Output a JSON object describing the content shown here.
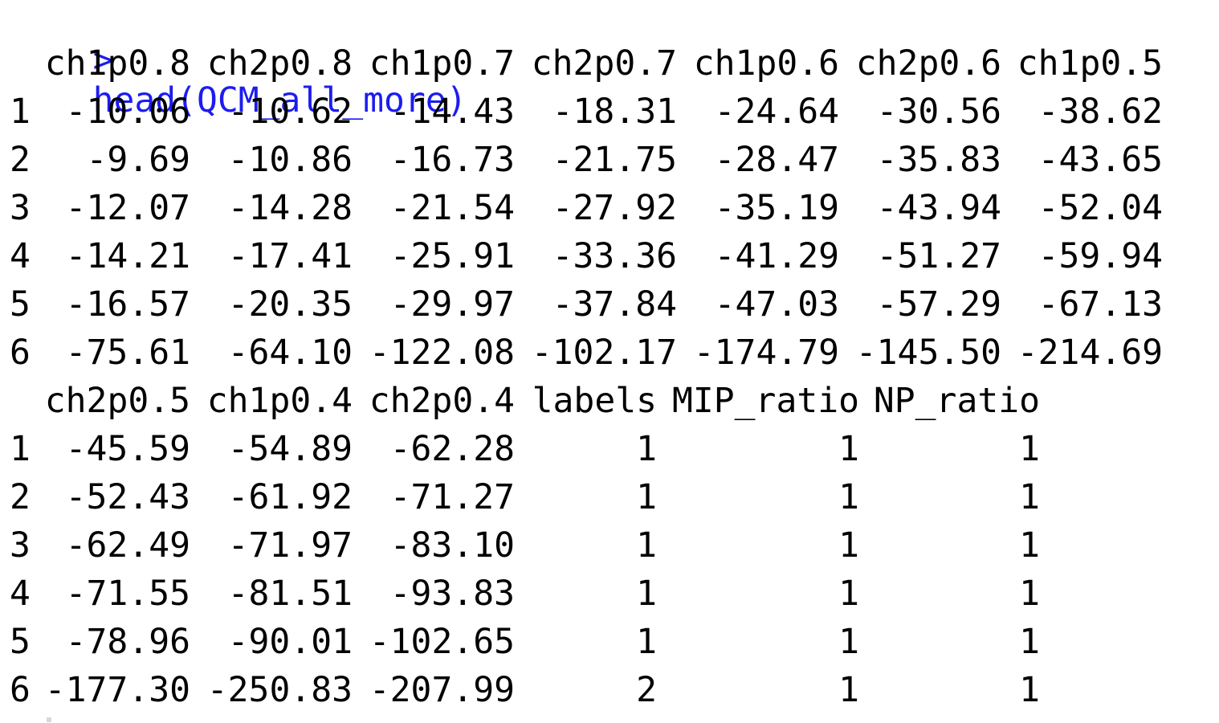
{
  "console": {
    "prompt": ">",
    "command": "head(QCM_all_more)",
    "colors": {
      "command": "#1c1cf0",
      "output": "#000000",
      "background": "#ffffff"
    }
  },
  "blocks": [
    {
      "headers": [
        "ch1p0.8",
        "ch2p0.8",
        "ch1p0.7",
        "ch2p0.7",
        "ch1p0.6",
        "ch2p0.6",
        "ch1p0.5"
      ],
      "rows": [
        {
          "name": "1",
          "cells": [
            "-10.06",
            "-10.62",
            "-14.43",
            "-18.31",
            "-24.64",
            "-30.56",
            "-38.62"
          ]
        },
        {
          "name": "2",
          "cells": [
            "-9.69",
            "-10.86",
            "-16.73",
            "-21.75",
            "-28.47",
            "-35.83",
            "-43.65"
          ]
        },
        {
          "name": "3",
          "cells": [
            "-12.07",
            "-14.28",
            "-21.54",
            "-27.92",
            "-35.19",
            "-43.94",
            "-52.04"
          ]
        },
        {
          "name": "4",
          "cells": [
            "-14.21",
            "-17.41",
            "-25.91",
            "-33.36",
            "-41.29",
            "-51.27",
            "-59.94"
          ]
        },
        {
          "name": "5",
          "cells": [
            "-16.57",
            "-20.35",
            "-29.97",
            "-37.84",
            "-47.03",
            "-57.29",
            "-67.13"
          ]
        },
        {
          "name": "6",
          "cells": [
            "-75.61",
            "-64.10",
            "-122.08",
            "-102.17",
            "-174.79",
            "-145.50",
            "-214.69"
          ]
        }
      ]
    },
    {
      "headers": [
        "ch2p0.5",
        "ch1p0.4",
        "ch2p0.4",
        "labels",
        "MIP_ratio",
        "NP_ratio"
      ],
      "rows": [
        {
          "name": "1",
          "cells": [
            "-45.59",
            "-54.89",
            "-62.28",
            "1",
            "1",
            "1"
          ]
        },
        {
          "name": "2",
          "cells": [
            "-52.43",
            "-61.92",
            "-71.27",
            "1",
            "1",
            "1"
          ]
        },
        {
          "name": "3",
          "cells": [
            "-62.49",
            "-71.97",
            "-83.10",
            "1",
            "1",
            "1"
          ]
        },
        {
          "name": "4",
          "cells": [
            "-71.55",
            "-81.51",
            "-93.83",
            "1",
            "1",
            "1"
          ]
        },
        {
          "name": "5",
          "cells": [
            "-78.96",
            "-90.01",
            "-102.65",
            "1",
            "1",
            "1"
          ]
        },
        {
          "name": "6",
          "cells": [
            "-177.30",
            "-250.83",
            "-207.99",
            "2",
            "1",
            "1"
          ]
        }
      ]
    }
  ]
}
